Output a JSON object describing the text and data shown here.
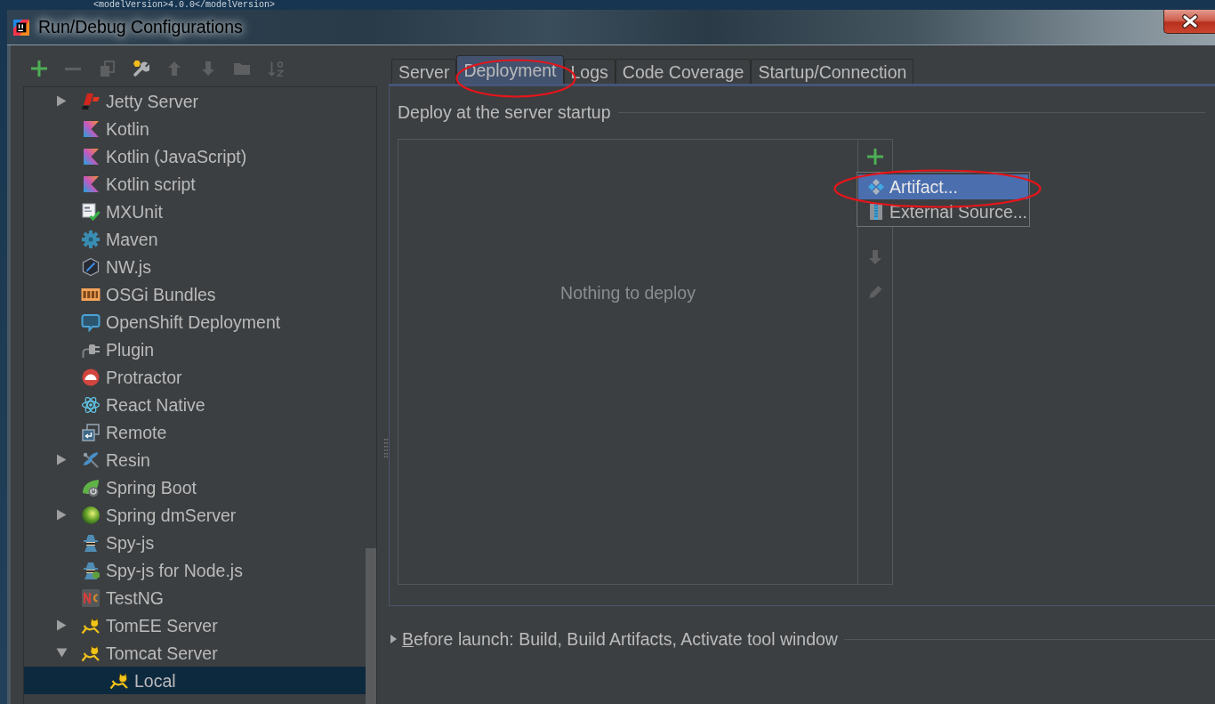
{
  "background_editor": {
    "text": "<modelVersion>4.0.0</modelVersion>"
  },
  "window": {
    "title": "Run/Debug Configurations"
  },
  "toolbar": [
    {
      "disabled": false
    },
    {
      "disabled": true
    },
    {
      "disabled": true
    },
    {
      "disabled": false
    },
    {
      "disabled": true
    },
    {
      "disabled": true
    },
    {
      "disabled": true
    },
    {
      "disabled": true
    }
  ],
  "tree": {
    "items": [
      {
        "label": "Jetty Server",
        "kind": "group",
        "expanded": false,
        "selected": false
      },
      {
        "label": "Kotlin",
        "kind": "config",
        "selected": false
      },
      {
        "label": "Kotlin (JavaScript)",
        "kind": "config",
        "selected": false
      },
      {
        "label": "Kotlin script",
        "kind": "config",
        "selected": false
      },
      {
        "label": "MXUnit",
        "kind": "config",
        "selected": false
      },
      {
        "label": "Maven",
        "kind": "config",
        "selected": false
      },
      {
        "label": "NW.js",
        "kind": "config",
        "selected": false
      },
      {
        "label": "OSGi Bundles",
        "kind": "config",
        "selected": false
      },
      {
        "label": "OpenShift Deployment",
        "kind": "config",
        "selected": false
      },
      {
        "label": "Plugin",
        "kind": "config",
        "selected": false
      },
      {
        "label": "Protractor",
        "kind": "config",
        "selected": false
      },
      {
        "label": "React Native",
        "kind": "config",
        "selected": false
      },
      {
        "label": "Remote",
        "kind": "config",
        "selected": false
      },
      {
        "label": "Resin",
        "kind": "group",
        "expanded": false,
        "selected": false
      },
      {
        "label": "Spring Boot",
        "kind": "config",
        "selected": false
      },
      {
        "label": "Spring dmServer",
        "kind": "group",
        "expanded": false,
        "selected": false
      },
      {
        "label": "Spy-js",
        "kind": "config",
        "selected": false
      },
      {
        "label": "Spy-js for Node.js",
        "kind": "config",
        "selected": false
      },
      {
        "label": "TestNG",
        "kind": "config",
        "selected": false
      },
      {
        "label": "TomEE Server",
        "kind": "group",
        "expanded": false,
        "selected": false
      },
      {
        "label": "Tomcat Server",
        "kind": "group",
        "expanded": true,
        "selected": false,
        "children": [
          {
            "label": "Local",
            "kind": "config",
            "selected": true
          }
        ]
      }
    ]
  },
  "tabs": [
    {
      "label": "Server",
      "selected": false,
      "circled": false
    },
    {
      "label": "Deployment",
      "selected": true,
      "circled": true
    },
    {
      "label": "Logs",
      "selected": false,
      "circled": false
    },
    {
      "label": "Code Coverage",
      "selected": false,
      "circled": false
    },
    {
      "label": "Startup/Connection",
      "selected": false,
      "circled": false
    }
  ],
  "deployment": {
    "section_title": "Deploy at the server startup",
    "empty_text": "Nothing to deploy",
    "tools": [
      {
        "disabled": false
      },
      {
        "disabled": true
      },
      {
        "disabled": true
      }
    ],
    "add_menu": [
      {
        "label": "Artifact...",
        "selected": true,
        "circled": true
      },
      {
        "label": "External Source...",
        "selected": false,
        "circled": false
      }
    ]
  },
  "before_launch": {
    "label": "Before launch: Build, Build Artifacts, Activate tool window",
    "expanded": false
  }
}
